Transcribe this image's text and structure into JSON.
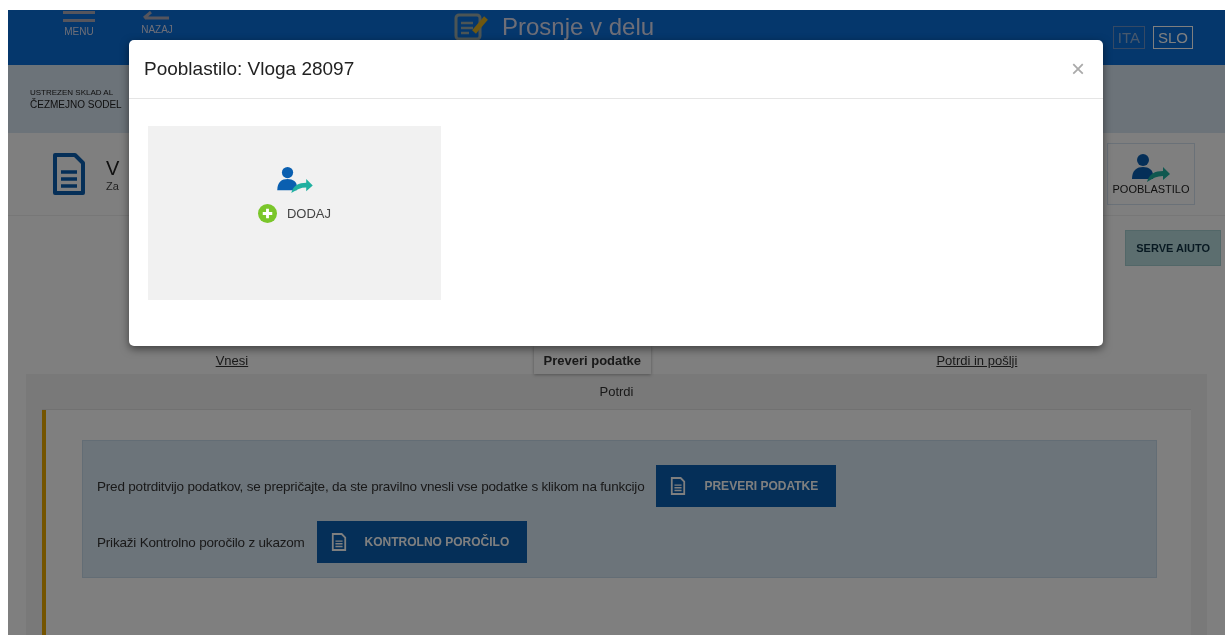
{
  "header": {
    "menu_label": "MENU",
    "back_label": "NAZAJ",
    "title": "Prosnje v delu",
    "languages": [
      {
        "label": "ITA",
        "selected": false
      },
      {
        "label": "SLO",
        "selected": true
      }
    ]
  },
  "context_band": {
    "line_1": "USTREZEN SKLAD AL",
    "line_2": "ČEZMEJNO SODEL"
  },
  "application": {
    "title": "V",
    "subtitle": "Za",
    "proxy_button": "POOBLASTILO"
  },
  "help_button": "SERVE AIUTO",
  "steps": [
    {
      "label": "Vnesi",
      "selected": false
    },
    {
      "label": "Preveri podatke",
      "selected": true
    },
    {
      "label": "Potrdi in pošlji",
      "selected": false
    }
  ],
  "panel": {
    "title": "Potrdi",
    "notices": [
      {
        "text": "Pred potrditvijo podatkov, se prepričajte, da ste pravilno vnesli vse podatke s klikom na funkcijo",
        "button": "PREVERI PODATKE"
      },
      {
        "text": "Prikaži Kontrolno poročilo z ukazom",
        "button": "KONTROLNO POROČILO"
      }
    ]
  },
  "modal": {
    "title": "Pooblastilo: Vloga 28097",
    "close": "×",
    "add_label": "DODAJ"
  }
}
